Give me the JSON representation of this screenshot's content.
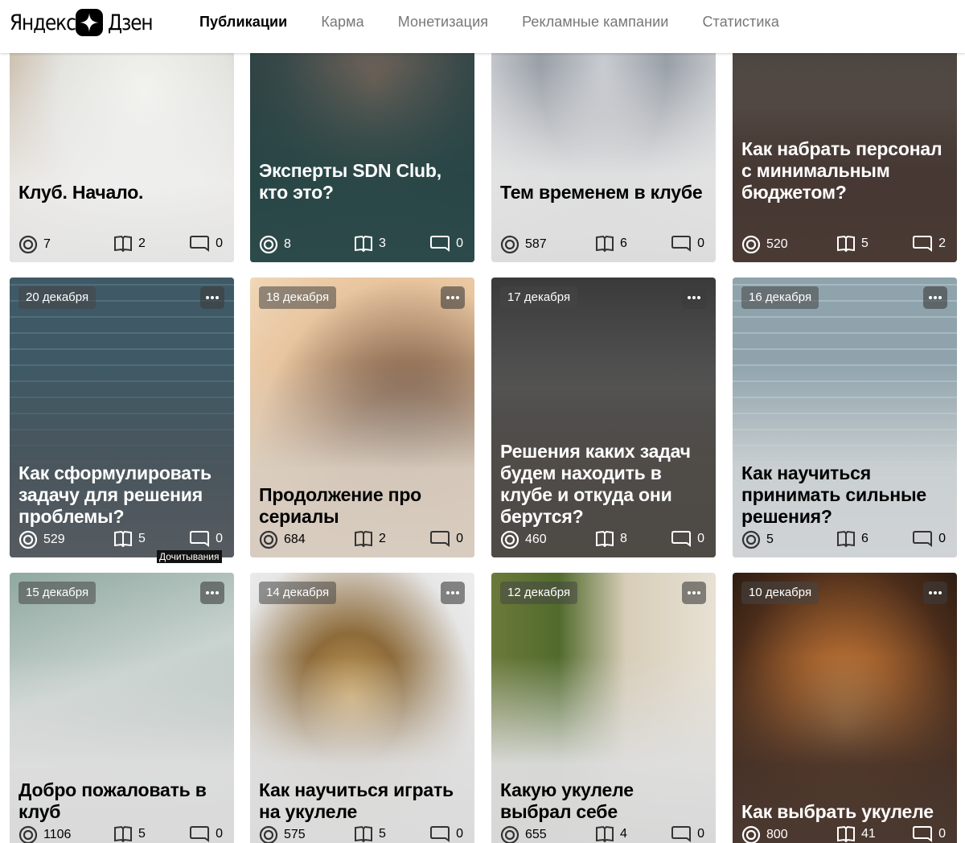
{
  "header": {
    "logo_text_left": "Яндекс",
    "logo_text_right": "Дзен",
    "logo_icon": "zen-star-icon",
    "tabs": [
      {
        "label": "Публикации",
        "active": true
      },
      {
        "label": "Карма",
        "active": false
      },
      {
        "label": "Монетизация",
        "active": false
      },
      {
        "label": "Рекламные кампании",
        "active": false
      },
      {
        "label": "Статистика",
        "active": false
      }
    ]
  },
  "icons": {
    "views": "eye-target-icon",
    "reads": "open-book-icon",
    "comments": "comment-bubble-icon",
    "more": "more-dots-icon"
  },
  "tooltip": {
    "text": "Дочитывания"
  },
  "cards": [
    {
      "title": "Клуб. Начало.",
      "date": "",
      "views": "7",
      "reads": "2",
      "comments": "0",
      "theme": "light"
    },
    {
      "title": "Эксперты SDN Club, кто это?",
      "date": "",
      "views": "8",
      "reads": "3",
      "comments": "0",
      "theme": "dark"
    },
    {
      "title": "Тем временем в клубе",
      "date": "",
      "views": "587",
      "reads": "6",
      "comments": "0",
      "theme": "light"
    },
    {
      "title": "Как набрать персонал с минимальным бюджетом?",
      "date": "",
      "views": "520",
      "reads": "5",
      "comments": "2",
      "theme": "dark"
    },
    {
      "title": "Как сформулировать задачу для решения проблемы?",
      "date": "20 декабря",
      "views": "529",
      "reads": "5",
      "comments": "0",
      "theme": "dark"
    },
    {
      "title": "Продолжение про сериалы",
      "date": "18 декабря",
      "views": "684",
      "reads": "2",
      "comments": "0",
      "theme": "light"
    },
    {
      "title": "Решения каких задач будем находить в клубе и откуда они берутся?",
      "date": "17 декабря",
      "views": "460",
      "reads": "8",
      "comments": "0",
      "theme": "dark"
    },
    {
      "title": "Как научиться принимать сильные решения?",
      "date": "16 декабря",
      "views": "5",
      "reads": "6",
      "comments": "0",
      "theme": "light"
    },
    {
      "title": "Добро пожаловать в клуб",
      "date": "15 декабря",
      "views": "1106",
      "reads": "5",
      "comments": "0",
      "theme": "light"
    },
    {
      "title": "Как научиться играть на укулеле",
      "date": "14 декабря",
      "views": "575",
      "reads": "5",
      "comments": "0",
      "theme": "light"
    },
    {
      "title": "Какую укулеле выбрал себе",
      "date": "12 декабря",
      "views": "655",
      "reads": "4",
      "comments": "0",
      "theme": "light"
    },
    {
      "title": "Как выбрать укулеле",
      "date": "10 декабря",
      "views": "800",
      "reads": "41",
      "comments": "0",
      "theme": "dark"
    }
  ]
}
